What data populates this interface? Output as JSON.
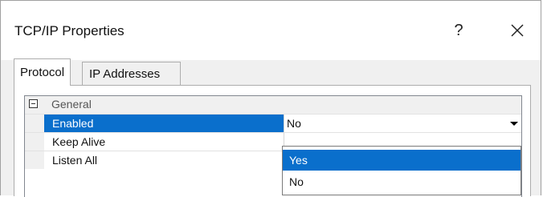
{
  "window": {
    "title": "TCP/IP Properties",
    "help_label": "?"
  },
  "tabs": [
    {
      "label": "Protocol",
      "active": true
    },
    {
      "label": "IP Addresses",
      "active": false
    }
  ],
  "property_grid": {
    "category": {
      "label": "General",
      "expanded": true
    },
    "rows": [
      {
        "name": "Enabled",
        "value": "No",
        "selected": true
      },
      {
        "name": "Keep Alive",
        "value": ""
      },
      {
        "name": "Listen All",
        "value": ""
      }
    ]
  },
  "dropdown": {
    "options": [
      "Yes",
      "No"
    ],
    "highlighted": "Yes"
  },
  "colors": {
    "selection": "#0a6fcc",
    "dialog_background": "#f0f0f0"
  }
}
